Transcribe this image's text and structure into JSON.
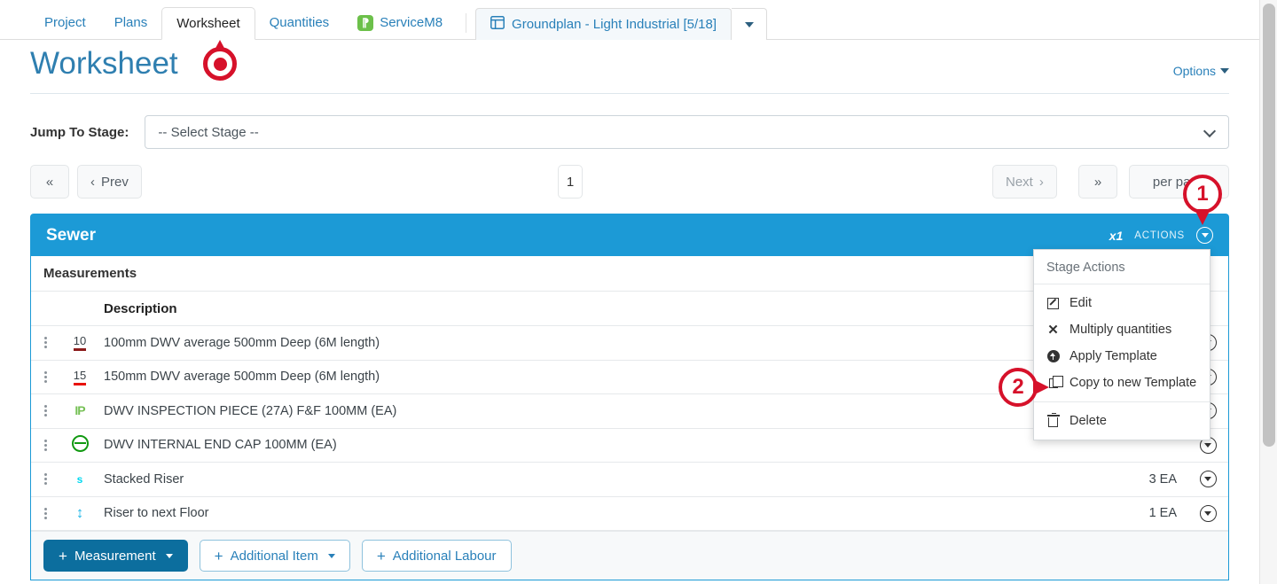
{
  "tabs": [
    {
      "label": "Project",
      "active": false,
      "icon": null
    },
    {
      "label": "Plans",
      "active": false,
      "icon": null
    },
    {
      "label": "Worksheet",
      "active": true,
      "icon": null
    },
    {
      "label": "Quantities",
      "active": false,
      "icon": null
    },
    {
      "label": "ServiceM8",
      "active": false,
      "icon": "servicem8-icon"
    }
  ],
  "document_tab": {
    "label": "Groundplan - Light Industrial [5/18]",
    "icon": "layout-panel-icon",
    "caret_icon": "chevron-down-icon"
  },
  "header": {
    "title": "Worksheet",
    "options_label": "Options",
    "options_caret": "caret-down-icon"
  },
  "jump_to_stage": {
    "label": "Jump To Stage:",
    "selected": "-- Select Stage --",
    "chevron": "chevron-down-icon"
  },
  "pagination": {
    "first_label": "«",
    "prev_label": "Prev",
    "prev_chevron": "‹",
    "current_page": "1",
    "next_label": "Next",
    "next_chevron": "›",
    "last_label": "»",
    "per_page_label": "per page"
  },
  "stage": {
    "name": "Sewer",
    "multiplier": "x1",
    "actions_label": "ACTIONS",
    "actions_caret": "circle-caret-down-icon",
    "section_label": "Measurements",
    "columns": {
      "handle": "",
      "icon": "",
      "description": "Description",
      "quantity": "",
      "action": ""
    },
    "rows": [
      {
        "handle": "drag-handle-icon",
        "icon_type": "measure-number-dark",
        "icon_text": "10",
        "description": "100mm DWV average 500mm Deep (6M length)",
        "quantity": "",
        "action": "row-caret-icon"
      },
      {
        "handle": "drag-handle-icon",
        "icon_type": "measure-number-red",
        "icon_text": "15",
        "description": "150mm DWV average 500mm Deep (6M length)",
        "quantity": "",
        "action": "row-caret-icon"
      },
      {
        "handle": "drag-handle-icon",
        "icon_type": "ip-icon",
        "icon_text": "IP",
        "description": "DWV INSPECTION PIECE (27A) F&F 100MM (EA)",
        "quantity": "",
        "action": "row-caret-icon"
      },
      {
        "handle": "drag-handle-icon",
        "icon_type": "end-cap-icon",
        "icon_text": "",
        "description": "DWV INTERNAL END CAP 100MM (EA)",
        "quantity": "",
        "action": "row-caret-icon"
      },
      {
        "handle": "drag-handle-icon",
        "icon_type": "s-icon",
        "icon_text": "s",
        "description": "Stacked Riser",
        "quantity": "3 EA",
        "action": "row-caret-icon"
      },
      {
        "handle": "drag-handle-icon",
        "icon_type": "riser-arrows-icon",
        "icon_text": "",
        "description": "Riser to next Floor",
        "quantity": "1 EA",
        "action": "row-caret-icon"
      }
    ],
    "footer_buttons": [
      {
        "label": "Measurement",
        "style": "primary",
        "plus": "+",
        "caret": true
      },
      {
        "label": "Additional Item",
        "style": "outline",
        "plus": "+",
        "caret": true
      },
      {
        "label": "Additional Labour",
        "style": "outline",
        "plus": "+",
        "caret": false
      }
    ]
  },
  "stage_actions_menu": {
    "title": "Stage Actions",
    "groups": [
      {
        "items": [
          {
            "label": "Edit",
            "icon": "edit-square-icon"
          },
          {
            "label": "Multiply quantities",
            "icon": "multiply-x-icon"
          },
          {
            "label": "Apply Template",
            "icon": "arrow-up-circle-icon"
          },
          {
            "label": "Copy to new Template",
            "icon": "copy-icon"
          }
        ]
      },
      {
        "items": [
          {
            "label": "Delete",
            "icon": "trash-icon"
          }
        ]
      }
    ]
  },
  "annotations": [
    {
      "id": "marker-1",
      "label": "1",
      "shape": "pin-down"
    },
    {
      "id": "marker-2",
      "label": "2",
      "shape": "pin-right"
    },
    {
      "id": "cursor-marker",
      "label": "",
      "shape": "click-target"
    }
  ],
  "colors": {
    "accent_blue": "#1c9ad6",
    "link_blue": "#2980b9",
    "primary_button": "#0c6e9e",
    "annotation_red": "#d6112a",
    "title_blue": "#2f7fb0"
  }
}
